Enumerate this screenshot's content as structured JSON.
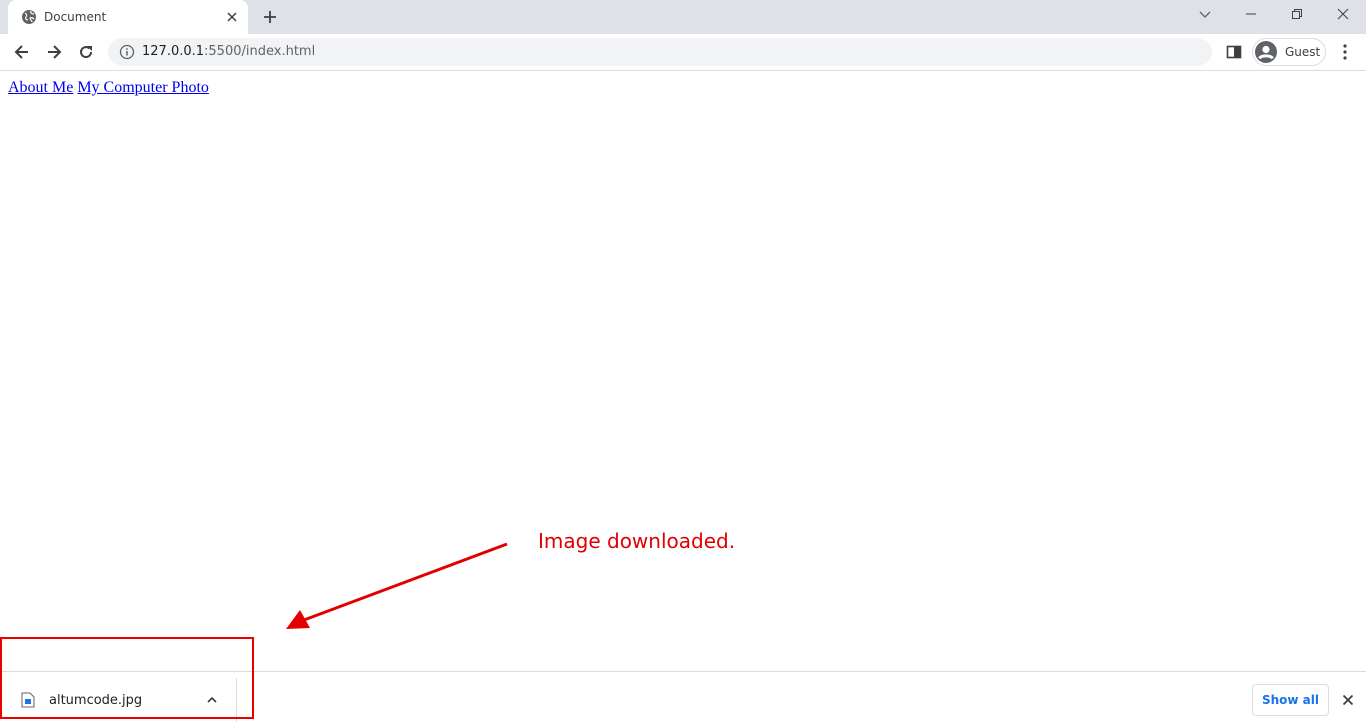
{
  "tab": {
    "title": "Document",
    "favicon": "globe-icon"
  },
  "toolbar": {
    "url_host": "127.0.0.1",
    "url_path": ":5500/index.html",
    "profile_label": "Guest"
  },
  "page": {
    "links": [
      {
        "label": "About Me"
      },
      {
        "label": "My Computer Photo"
      }
    ]
  },
  "annotation": {
    "text": "Image downloaded.",
    "color": "#e00000"
  },
  "downloads": {
    "items": [
      {
        "filename": "altumcode.jpg",
        "icon": "image-file-icon"
      }
    ],
    "show_all_label": "Show all"
  },
  "colors": {
    "tabstrip_bg": "#dee1e6",
    "link": "#0000ee",
    "accent": "#1a73e8"
  }
}
